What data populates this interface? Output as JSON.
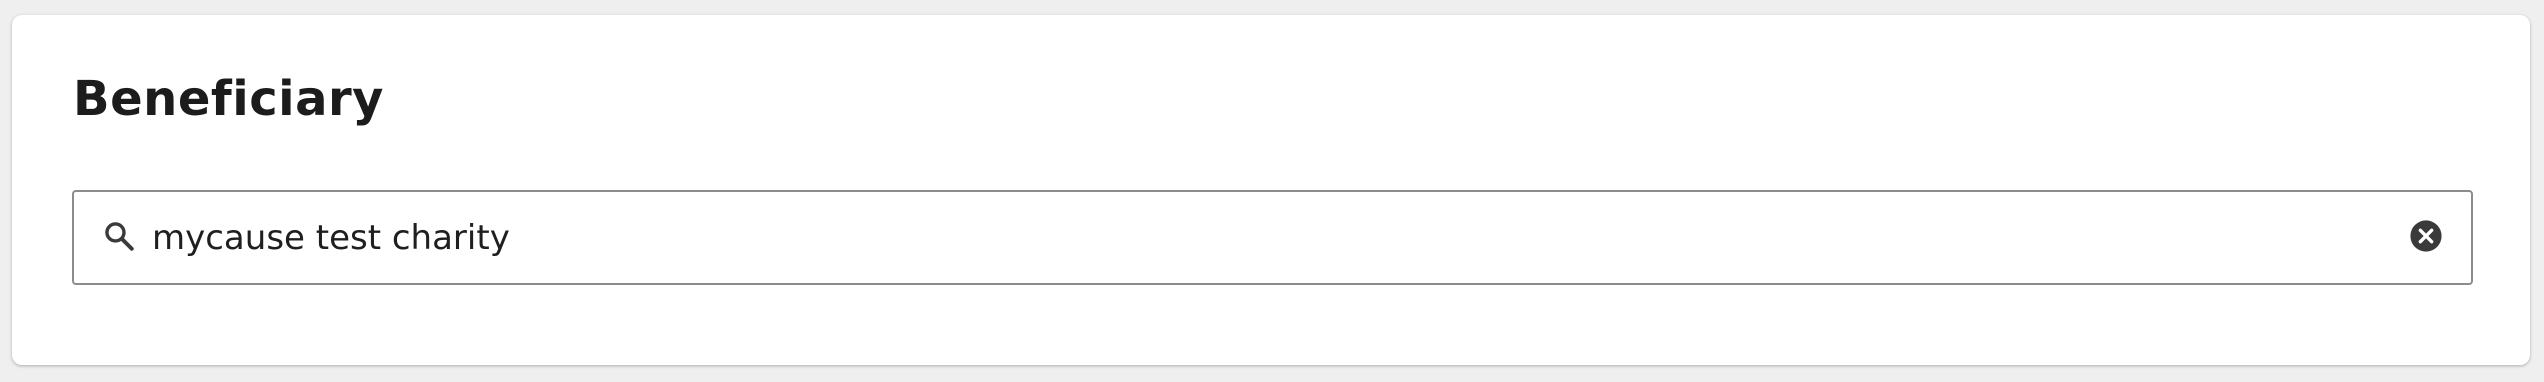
{
  "section": {
    "title": "Beneficiary"
  },
  "search": {
    "value": "mycause test charity",
    "search_icon": "search-icon",
    "clear_icon": "close-circle-icon"
  },
  "colors": {
    "page_background": "#efefef",
    "card_background": "#ffffff",
    "input_border": "#8c8c8c",
    "text": "#1f1f1f",
    "icon": "#3a3a3a"
  }
}
